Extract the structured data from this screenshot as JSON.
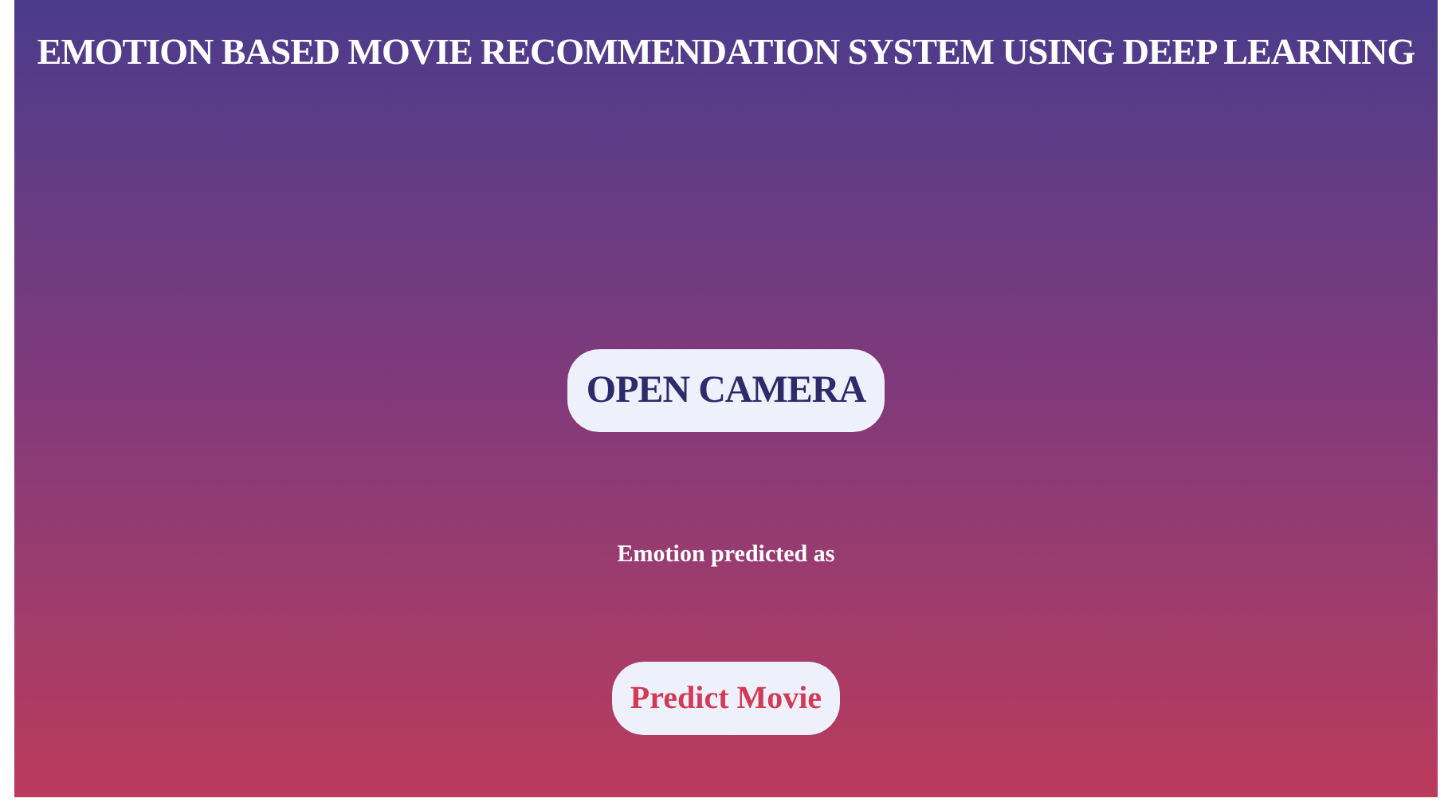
{
  "title": "EMOTION BASED MOVIE RECOMMENDATION SYSTEM USING DEEP LEARNING",
  "open_camera_button": "OPEN CAMERA",
  "emotion_label": "Emotion predicted as",
  "predict_button": "Predict Movie"
}
